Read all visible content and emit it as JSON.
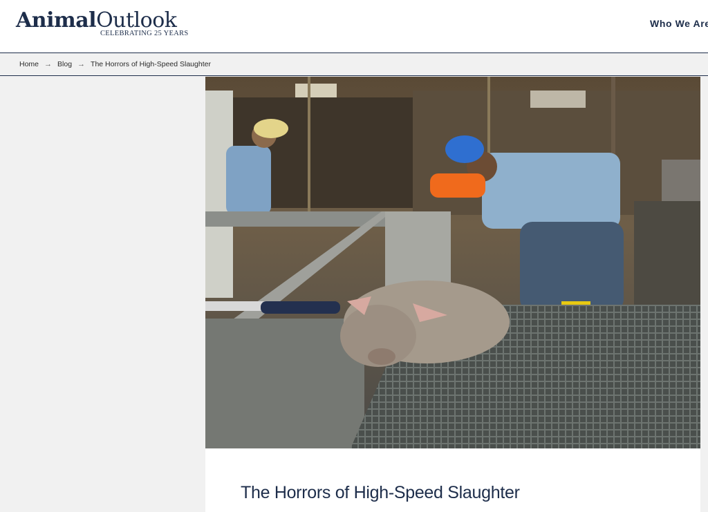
{
  "brand": {
    "name_bold": "Animal",
    "name_light": "Outlook",
    "tagline": "CELEBRATING 25 YEARS"
  },
  "nav": {
    "items": [
      "Who We Are"
    ]
  },
  "breadcrumb": {
    "items": [
      "Home",
      "Blog",
      "The Horrors of High-Speed Slaughter"
    ],
    "separator": "→"
  },
  "article": {
    "title": "The Horrors of High-Speed Slaughter",
    "hero_image": "slaughterhouse-workers-with-pig-photo"
  },
  "colors": {
    "brand_navy": "#1d2d4a",
    "page_bg": "#f1f1f1"
  }
}
